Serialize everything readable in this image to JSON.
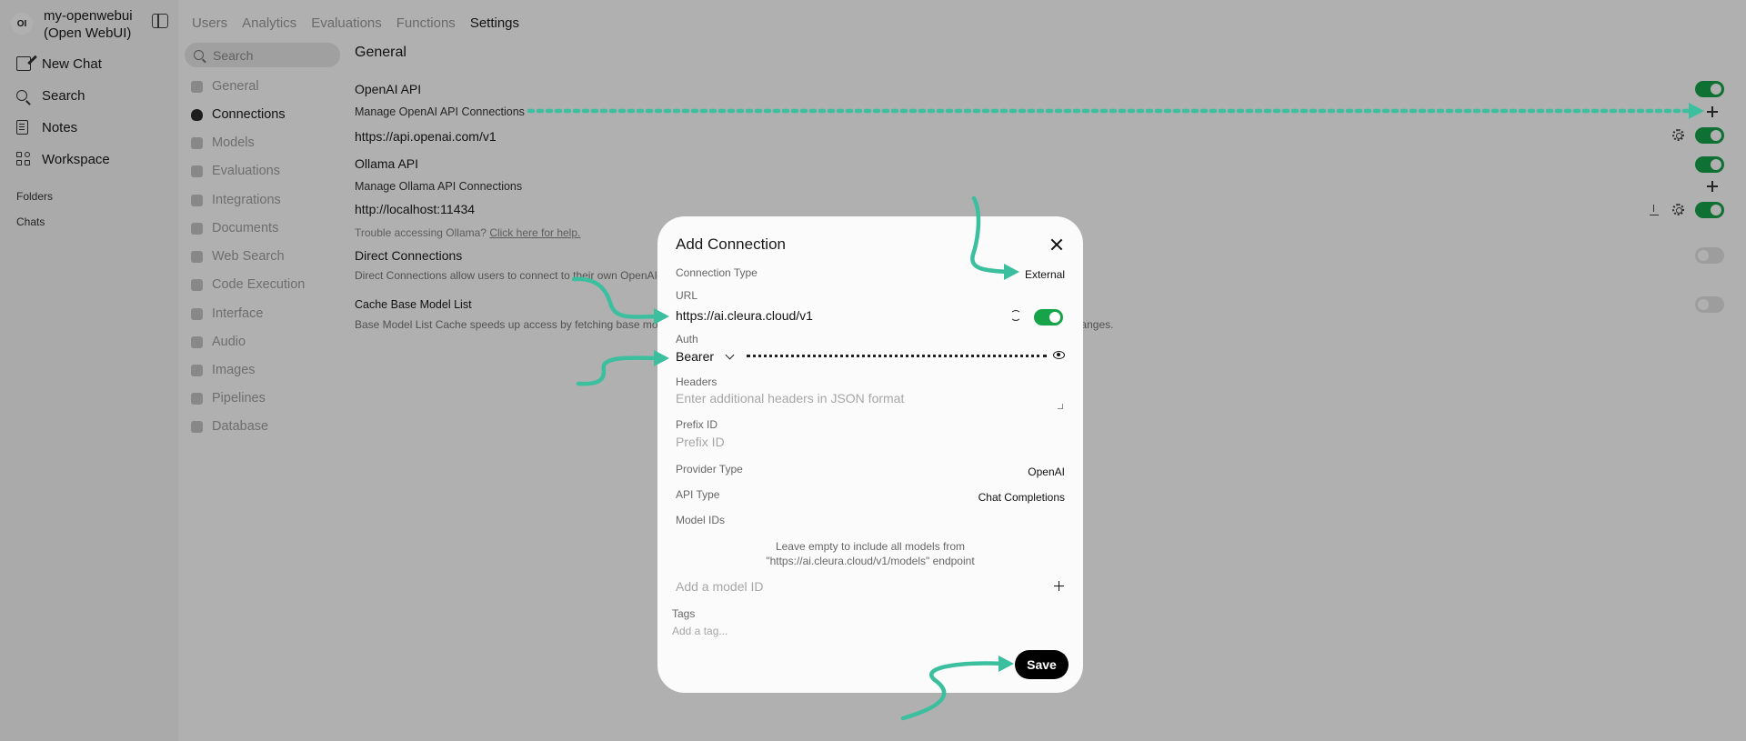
{
  "sidebar": {
    "logo_text": "OI",
    "app_name": "my-openwebui (Open WebUI)",
    "nav": [
      {
        "label": "New Chat",
        "icon": "edit-icon"
      },
      {
        "label": "Search",
        "icon": "search-icon"
      },
      {
        "label": "Notes",
        "icon": "notes-icon"
      },
      {
        "label": "Workspace",
        "icon": "workspace-icon"
      }
    ],
    "folders_label": "Folders",
    "chats_label": "Chats"
  },
  "top_tabs": [
    "Users",
    "Analytics",
    "Evaluations",
    "Functions",
    "Settings"
  ],
  "settings_nav": {
    "search_placeholder": "Search",
    "items": [
      "General",
      "Connections",
      "Models",
      "Evaluations",
      "Integrations",
      "Documents",
      "Web Search",
      "Code Execution",
      "Interface",
      "Audio",
      "Images",
      "Pipelines",
      "Database"
    ],
    "active": "Connections"
  },
  "main": {
    "title": "General",
    "openai_title": "OpenAI API",
    "openai_manage": "Manage OpenAI API Connections",
    "openai_url": "https://api.openai.com/v1",
    "ollama_title": "Ollama API",
    "ollama_manage": "Manage Ollama API Connections",
    "ollama_url": "http://localhost:11434",
    "ollama_help_prefix": "Trouble accessing Ollama?",
    "ollama_help_link": "Click here for help.",
    "direct_title": "Direct Connections",
    "direct_desc": "Direct Connections allow users to connect to their own OpenAI compatible API endpoints.",
    "cache_title": "Cache Base Model List",
    "cache_desc": "Base Model List Cache speeds up access by fetching base models only at startup or on settings save—faster, but may not show recent base model changes."
  },
  "modal": {
    "title": "Add Connection",
    "connection_type_label": "Connection Type",
    "connection_type_value": "External",
    "url_label": "URL",
    "url_value": "https://ai.cleura.cloud/v1",
    "auth_label": "Auth",
    "auth_value": "Bearer",
    "headers_label": "Headers",
    "headers_placeholder": "Enter additional headers in JSON format",
    "prefix_label": "Prefix ID",
    "prefix_placeholder": "Prefix ID",
    "provider_label": "Provider Type",
    "provider_value": "OpenAI",
    "api_type_label": "API Type",
    "api_type_value": "Chat Completions",
    "model_ids_label": "Model IDs",
    "model_ids_hint": "Leave empty to include all models from \"https://ai.cleura.cloud/v1/models\" endpoint",
    "add_model_placeholder": "Add a model ID",
    "tags_label": "Tags",
    "tags_placeholder": "Add a tag...",
    "save_label": "Save"
  },
  "colors": {
    "accent_green": "#16a34a",
    "annotation_teal": "#3bbf9f",
    "overlay": "rgba(0,0,0,0.31)"
  }
}
